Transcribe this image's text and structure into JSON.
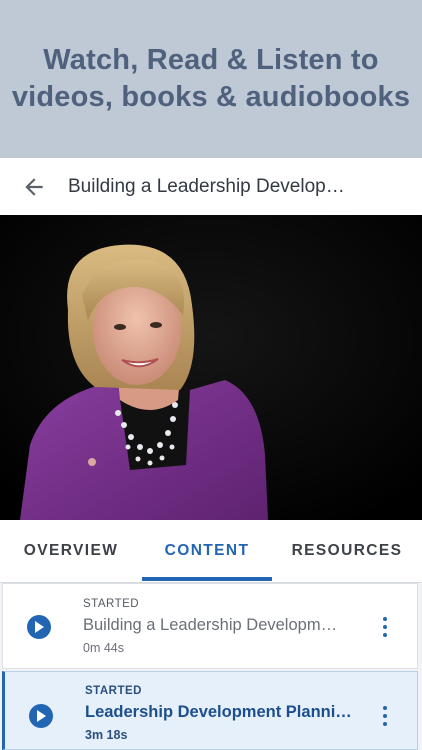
{
  "promo": {
    "line1": "Watch, Read & Listen to",
    "line2": "videos, books & audiobooks"
  },
  "appbar": {
    "back_icon": "arrow-left-icon",
    "title": "Building a Leadership Develop…"
  },
  "tabs": [
    {
      "label": "OVERVIEW",
      "active": false
    },
    {
      "label": "CONTENT",
      "active": true
    },
    {
      "label": "RESOURCES",
      "active": false
    }
  ],
  "content_items": [
    {
      "status": "STARTED",
      "title": "Building a Leadership Developm…",
      "duration": "0m 44s",
      "active": false,
      "play_icon": "play-icon",
      "menu_icon": "more-vertical-icon"
    },
    {
      "status": "STARTED",
      "title": "Leadership Development Planni…",
      "duration": "3m 18s",
      "active": true,
      "play_icon": "play-icon",
      "menu_icon": "more-vertical-icon"
    }
  ],
  "colors": {
    "promo_bg": "#bfc8d5",
    "promo_text": "#4f617d",
    "accent": "#2265b3"
  }
}
